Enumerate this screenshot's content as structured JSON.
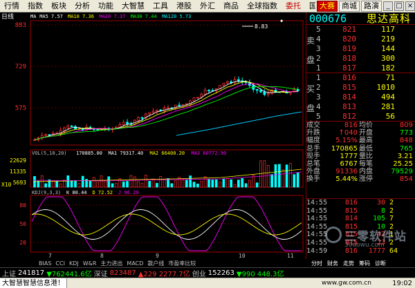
{
  "menu": [
    "行情",
    "指数",
    "板块",
    "分析",
    "功能",
    "大智慧",
    "工具",
    "港股",
    "外汇",
    "商品",
    "全球指数",
    "委托",
    "国海证券"
  ],
  "menu_red": [
    "委托"
  ],
  "toolbar": {
    "brand": "大赛",
    "store": "商城",
    "net": "路演"
  },
  "window_icons": {
    "minimize": "minimize-icon",
    "restore": "restore-icon",
    "close": "close-icon"
  },
  "stock": {
    "code": "000676",
    "name": "思达高科"
  },
  "main_chart": {
    "period": "日线",
    "ma_legend": [
      {
        "label": "MA",
        "color": "#ffffff"
      },
      {
        "label": "MA5 7.57",
        "color": "#ffffff"
      },
      {
        "label": "MA10 7.36",
        "color": "#ffff00"
      },
      {
        "label": "MA20 7.37",
        "color": "#ff00ff"
      },
      {
        "label": "MA30 7.44",
        "color": "#00ff00"
      },
      {
        "label": "MA120 5.73",
        "color": "#00ffff"
      }
    ],
    "price_axis": [
      "883",
      "729",
      "575"
    ],
    "high_mark": "8.83",
    "x_months": [
      "10",
      "11"
    ]
  },
  "vol_chart": {
    "title": "VOL(5,10,20)",
    "legend": [
      {
        "label": "170885.00",
        "color": "#ffffff"
      },
      {
        "label": "MA1 79317.40",
        "color": "#ffffff"
      },
      {
        "label": "MA2 66400.20",
        "color": "#ffff00"
      },
      {
        "label": "MA3 60772.90",
        "color": "#ff00ff"
      }
    ],
    "axis": [
      "22629",
      "11335",
      "5693"
    ],
    "unit": "X10"
  },
  "kdj_chart": {
    "title": "KDJ(9,3,3)",
    "legend": [
      {
        "label": "K 80.44",
        "color": "#ffffff"
      },
      {
        "label": "D 72.52",
        "color": "#ffff00"
      },
      {
        "label": "J 96.29",
        "color": "#ff00ff"
      }
    ],
    "axis": [
      "80",
      "50",
      "20"
    ],
    "x_labels": [
      "7",
      "8",
      "9",
      "10",
      "11"
    ]
  },
  "indicator_tabs": [
    "BIAS",
    "CCI",
    "KDJ",
    "W&R",
    "主力进出",
    "MACD",
    "散户线",
    "市盈率比较"
  ],
  "asks": [
    {
      "level": "5",
      "price": "821",
      "vol": "117"
    },
    {
      "level": "4",
      "price": "820",
      "vol": "219"
    },
    {
      "level": "3",
      "price": "819",
      "vol": "144"
    },
    {
      "level": "2",
      "price": "818",
      "vol": "300"
    },
    {
      "level": "1",
      "price": "817",
      "vol": "182"
    }
  ],
  "bids": [
    {
      "level": "1",
      "price": "816",
      "vol": "71"
    },
    {
      "level": "2",
      "price": "815",
      "vol": "1010"
    },
    {
      "level": "3",
      "price": "814",
      "vol": "494"
    },
    {
      "level": "4",
      "price": "813",
      "vol": "281"
    },
    {
      "level": "5",
      "price": "812",
      "vol": "56"
    }
  ],
  "ask_label": [
    "卖",
    "盘"
  ],
  "bid_label": [
    "买",
    "盘"
  ],
  "stats": [
    {
      "l1": "成交",
      "v1": "816",
      "c1": "red",
      "l2": "均价",
      "v2": "809",
      "c2": "red"
    },
    {
      "l1": "升跌",
      "v1": "↑040",
      "c1": "red",
      "l2": "开盘",
      "v2": "773",
      "c2": "grn"
    },
    {
      "l1": "幅度",
      "v1": "5.15%",
      "c1": "red",
      "l2": "最高",
      "v2": "848",
      "c2": "red"
    },
    {
      "l1": "总手",
      "v1": "170865",
      "c1": "yel",
      "l2": "最低",
      "v2": "765",
      "c2": "grn"
    },
    {
      "l1": "现手",
      "v1": "1777",
      "c1": "yel",
      "l2": "量比",
      "v2": "3.21",
      "c2": "yel"
    },
    {
      "l1": "总笔",
      "v1": "6767",
      "c1": "yel",
      "l2": "每笔",
      "v2": "25.25",
      "c2": "yel"
    },
    {
      "l1": "外盘",
      "v1": "91336",
      "c1": "red",
      "l2": "内盘",
      "v2": "79529",
      "c2": "grn"
    },
    {
      "l1": "换手",
      "v1": "5.44%",
      "c1": "yel",
      "l2": "涨停",
      "v2": "854",
      "c2": "red"
    }
  ],
  "ticks": [
    {
      "time": "14:55",
      "price": "816",
      "vol": "30",
      "dir": "2",
      "vc": "red"
    },
    {
      "time": "14:55",
      "price": "815",
      "vol": "8",
      "dir": "2",
      "vc": "grn"
    },
    {
      "time": "14:55",
      "price": "814",
      "vol": "105",
      "dir": "7",
      "vc": "grn"
    },
    {
      "time": "14:55",
      "price": "815",
      "vol": "10",
      "dir": "2",
      "vc": "grn"
    },
    {
      "time": "14:55",
      "price": "815",
      "vol": "42",
      "dir": "1",
      "vc": "red"
    },
    {
      "time": "14:55",
      "price": "815",
      "vol": "23",
      "dir": "2",
      "vc": "red"
    },
    {
      "time": "14:59",
      "price": "816",
      "vol": "1777",
      "dir": "64",
      "vc": "red"
    }
  ],
  "watermark": {
    "text": "三零软件站",
    "url": "30dowu.com"
  },
  "right_tabs": [
    "分时",
    "财务",
    "走势",
    "筹码",
    "诊断"
  ],
  "status": [
    {
      "label": "上证",
      "value": "241817",
      "color": "#ffffff"
    },
    {
      "label": "",
      "value": "▼762441.6亿",
      "color": "#00ff00"
    },
    {
      "label": "深证",
      "value": "823487",
      "color": "#ff3030"
    },
    {
      "label": "",
      "value": "▲229 2277.7亿",
      "color": "#ff3030"
    },
    {
      "label": "",
      "value": "创业",
      "color": "#c0c0c0"
    },
    {
      "label": "",
      "value": "152263",
      "color": "#ffffff"
    },
    {
      "label": "",
      "value": "▼990 448.3亿",
      "color": "#00ff00"
    }
  ],
  "bottom_bar": {
    "ticker": "大智慧智慧信息港！",
    "url": "www.gw.com.cn",
    "time": "19:02"
  }
}
